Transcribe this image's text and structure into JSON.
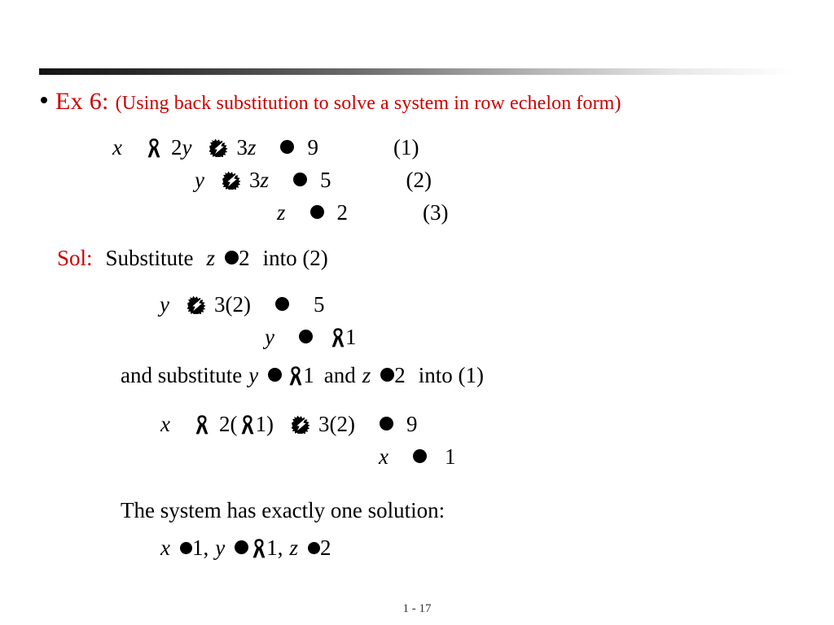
{
  "slide": {
    "background_color": "#ffffff",
    "accent_color": "#CC0000",
    "rule": {
      "name": "gradient-rule",
      "from_color": "#141414",
      "to_color": "#ffffff"
    }
  },
  "title": {
    "bullet": "•",
    "main": "Ex 6:",
    "sub": "(Using back substitution to solve a system in row echelon form)"
  },
  "glyphs": {
    "equals_name": "filled-circle-equals-glyph",
    "minus_name": "ribbon-minus-glyph",
    "plus_name": "burst-plus-glyph"
  },
  "system": {
    "eq1": {
      "x": "x",
      "two": "2",
      "y": "y",
      "three": "3",
      "z": "z",
      "rhs": "9",
      "tag": "(1)"
    },
    "eq2": {
      "y": "y",
      "three": "3",
      "z": "z",
      "rhs": "5",
      "tag": "(2)"
    },
    "eq3": {
      "z": "z",
      "rhs": "2",
      "tag": "(3)"
    }
  },
  "solution": {
    "sol_label": "Sol:",
    "step1_text": "Substitute",
    "step1_var": "z",
    "step1_val": "2",
    "step1_into": "into (2)",
    "work1_var": "y",
    "work1_term": "3(2)",
    "work1_rhs": "5",
    "work2_var": "y",
    "work2_rhs": "1",
    "step2_prefix": "and substitute",
    "step2_var1": "y",
    "step2_val1": "1",
    "step2_and": "and",
    "step2_var2": "z",
    "step2_val2": "2",
    "step2_into": "into (1)",
    "work3_x": "x",
    "work3_two": "2(",
    "work3_one": "1)",
    "work3_term": "3(2)",
    "work3_rhs": "9",
    "work4_var": "x",
    "work4_rhs": "1",
    "conclusion": "The system has exactly one solution:",
    "final_x_var": "x",
    "final_x_val": "1,",
    "final_y_var": "y",
    "final_y_val": "1,",
    "final_z_var": "z",
    "final_z_val": "2"
  },
  "footer": {
    "page": "1 - 17"
  }
}
